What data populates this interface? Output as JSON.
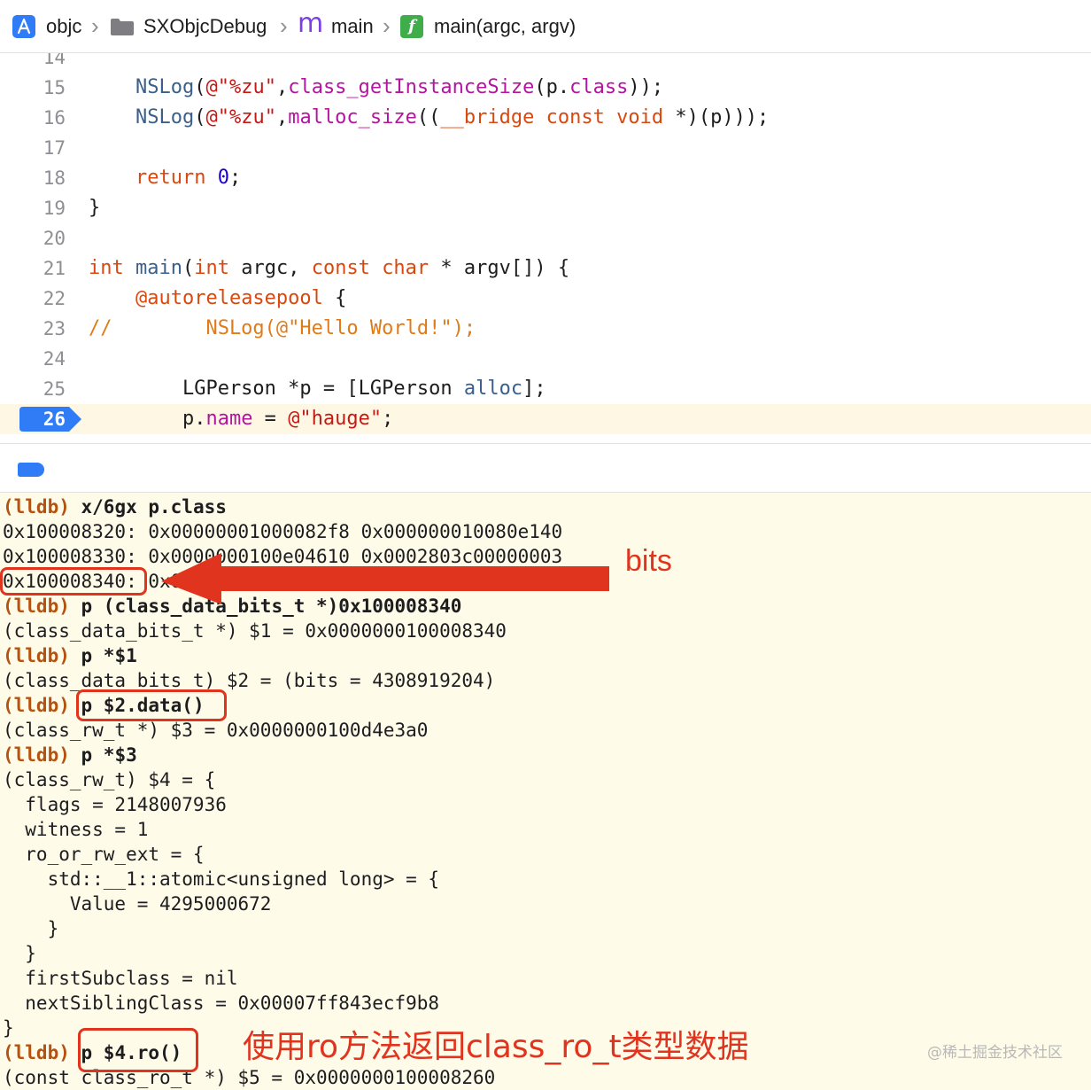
{
  "breadcrumb": {
    "items": [
      {
        "label": "objc",
        "icon": "xcode-project-icon"
      },
      {
        "label": "SXObjcDebug",
        "icon": "folder-icon"
      },
      {
        "label": "main",
        "icon": "m-file-icon"
      },
      {
        "label": "main(argc, argv)",
        "icon": "function-icon"
      }
    ],
    "m_glyph": "m",
    "f_glyph": "f"
  },
  "editor": {
    "current_line": "26",
    "lines": [
      {
        "n": "14"
      },
      {
        "n": "15",
        "t": [
          "    ",
          "NSLog",
          "(",
          "@\"%zu\"",
          ",",
          "class_getInstanceSize",
          "(p.",
          "class",
          "));"
        ]
      },
      {
        "n": "16",
        "t": [
          "    ",
          "NSLog",
          "(",
          "@\"%zu\"",
          ",",
          "malloc_size",
          "((",
          "__bridge",
          " ",
          "const",
          " ",
          "void",
          " *)(p)));"
        ]
      },
      {
        "n": "17"
      },
      {
        "n": "18",
        "t": [
          "    ",
          "return",
          " ",
          "0",
          ";"
        ]
      },
      {
        "n": "19",
        "t": [
          "}"
        ]
      },
      {
        "n": "20"
      },
      {
        "n": "21",
        "t": [
          "int",
          " ",
          "main",
          "(",
          "int",
          " argc, ",
          "const",
          " ",
          "char",
          " * argv[]) {"
        ]
      },
      {
        "n": "22",
        "t": [
          "    ",
          "@autoreleasepool",
          " {"
        ]
      },
      {
        "n": "23",
        "t": [
          "//        NSLog(@\"Hello World!\");"
        ]
      },
      {
        "n": "24"
      },
      {
        "n": "25",
        "t": [
          "        LGPerson *p = [LGPerson ",
          "alloc",
          "];"
        ]
      },
      {
        "n": "26",
        "t": [
          "        p.",
          "name",
          " = ",
          "@\"hauge\"",
          ";"
        ]
      }
    ]
  },
  "console": {
    "prompt": "(lldb)",
    "lines": [
      {
        "prompt": true,
        "cmd": "x/6gx p.class"
      },
      {
        "text": "0x100008320: 0x00000001000082f8 0x000000010080e140"
      },
      {
        "text": "0x100008330: 0x0000000100e04610 0x0002803c00000003"
      },
      {
        "text": "0x100008340: 0x0000000100d4e3a4 0x0000000000000000"
      },
      {
        "prompt": true,
        "cmd": "p (class_data_bits_t *)0x100008340"
      },
      {
        "text": "(class_data_bits_t *) $1 = 0x0000000100008340"
      },
      {
        "prompt": true,
        "cmd": "p *$1"
      },
      {
        "text": "(class_data_bits_t) $2 = (bits = 4308919204)"
      },
      {
        "prompt": true,
        "cmd": "p $2.data()"
      },
      {
        "text": "(class_rw_t *) $3 = 0x0000000100d4e3a0"
      },
      {
        "prompt": true,
        "cmd": "p *$3"
      },
      {
        "text": "(class_rw_t) $4 = {"
      },
      {
        "text": "  flags = 2148007936"
      },
      {
        "text": "  witness = 1"
      },
      {
        "text": "  ro_or_rw_ext = {"
      },
      {
        "text": "    std::__1::atomic<unsigned long> = {"
      },
      {
        "text": "      Value = 4295000672"
      },
      {
        "text": "    }"
      },
      {
        "text": "  }"
      },
      {
        "text": "  firstSubclass = nil"
      },
      {
        "text": "  nextSiblingClass = 0x00007ff843ecf9b8"
      },
      {
        "text": "}"
      },
      {
        "prompt": true,
        "cmd": "p $4.ro()"
      },
      {
        "text": "(const class_ro_t *) $5 = 0x0000000100008260"
      }
    ]
  },
  "annotations": {
    "bits_label": "bits",
    "ro_label": "使用ro方法返回class_ro_t类型数据",
    "accent_color": "#e0341f"
  },
  "watermark": "@稀土掘金技术社区"
}
